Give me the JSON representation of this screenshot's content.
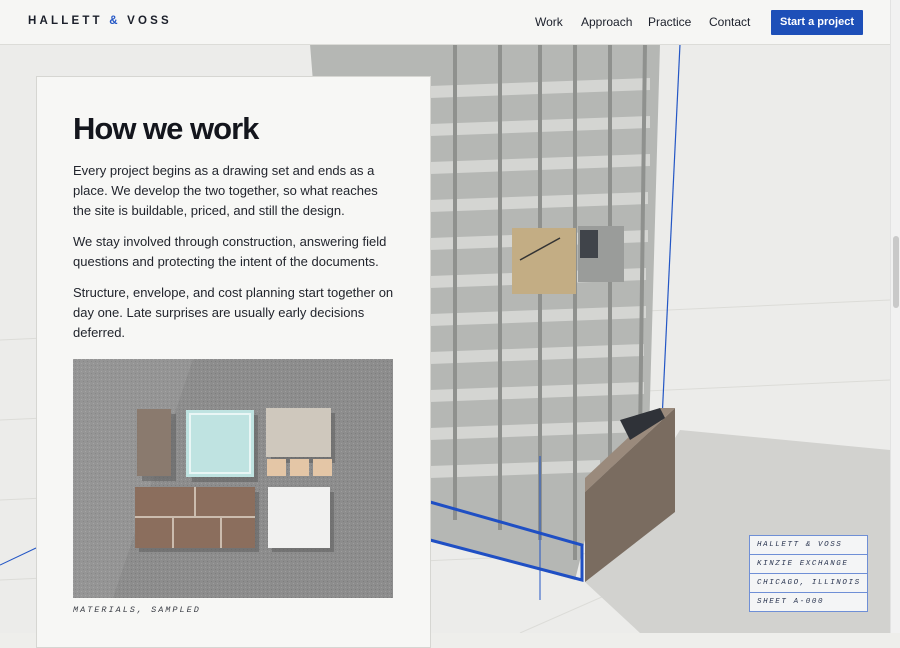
{
  "header": {
    "logo_left": "HALLETT ",
    "logo_amp": "&",
    "logo_right": " VOSS",
    "nav": [
      "Work",
      "Approach",
      "Practice",
      "Contact"
    ],
    "cta": "Start a project"
  },
  "card": {
    "heading": "How we work",
    "paragraphs": [
      "Every project begins as a drawing set and ends as a place. We develop the two together, so what reaches the site is buildable, priced, and still the design.",
      "We stay involved through construction, answering field questions and protecting the intent of the documents.",
      "Structure, envelope, and cost planning start together on day one. Late surprises are usually early decisions deferred."
    ],
    "photo_caption": "MATERIALS, SAMPLED"
  },
  "title_block": [
    "HALLETT & VOSS",
    "KINZIE EXCHANGE",
    "CHICAGO, ILLINOIS",
    "SHEET A-000"
  ],
  "colors": {
    "accent": "#1d4fb8",
    "drawing_line": "#2356c5",
    "page": "#eeeeeb",
    "text": "#14161d"
  }
}
